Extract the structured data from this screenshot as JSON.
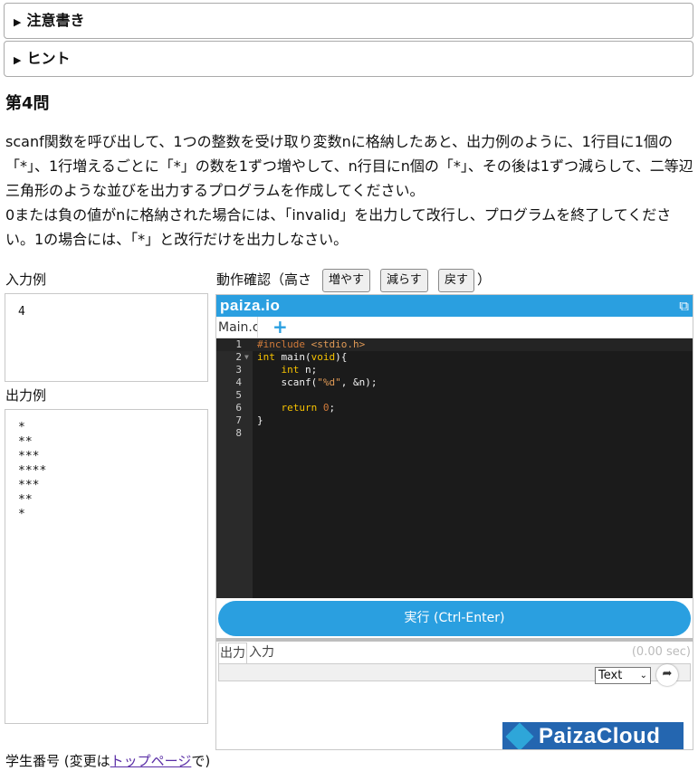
{
  "sections": {
    "notes": "注意書き",
    "hint": "ヒント"
  },
  "question": {
    "title": "第4問",
    "text": "scanf関数を呼び出して、1つの整数を受け取り変数nに格納したあと、出力例のように、1行目に1個の「*」、1行増えるごとに「*」の数を1ずつ増やして、n行目にn個の「*」、その後は1ずつ減らして、二等辺三角形のような並びを出力するプログラムを作成してください。\n0または負の値がnに格納された場合には、「invalid」を出力して改行し、プログラムを終了してください。1の場合には、「*」と改行だけを出力しなさい。"
  },
  "input_example": {
    "label": "入力例",
    "value": "4"
  },
  "output_example": {
    "label": "出力例",
    "value": "*\n**\n***\n****\n***\n**\n*"
  },
  "run_check": {
    "label_prefix": "動作確認（高さ",
    "increase": "増やす",
    "decrease": "減らす",
    "reset": "戻す",
    "label_suffix": "）"
  },
  "editor": {
    "logo": "paiza.io",
    "file_tab": "Main.c",
    "add_tab": "+",
    "external_icon": "external-link-icon",
    "code_lines": [
      "#include <stdio.h>",
      "int main(void){",
      "    int n;",
      "    scanf(\"%d\", &n);",
      "",
      "    return 0;",
      "}",
      ""
    ],
    "run_button": "実行 (Ctrl-Enter)",
    "tab_output": "出力",
    "tab_input": "入力",
    "elapsed": "(0.00 sec)",
    "format_select": "Text",
    "share_icon": "share-icon",
    "ad_text": "PaizaCloud"
  },
  "footer": {
    "prefix": "学生番号 (変更は",
    "link": "トップページ",
    "suffix": "で)"
  },
  "colors": {
    "accent": "#2a9fe0",
    "editor_bg": "#1b1b1b",
    "ad_bg": "#2466b0"
  }
}
